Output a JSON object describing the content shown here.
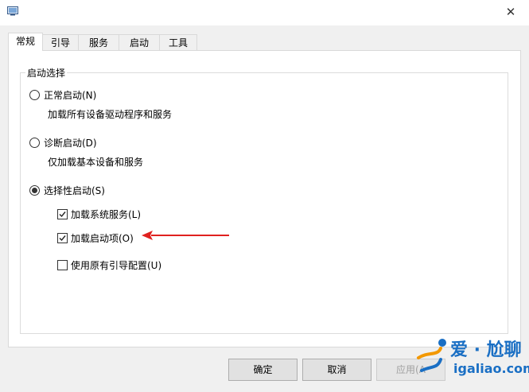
{
  "window": {
    "close_glyph": "✕"
  },
  "tabs": [
    {
      "label": "常规",
      "active": true
    },
    {
      "label": "引导"
    },
    {
      "label": "服务"
    },
    {
      "label": "启动"
    },
    {
      "label": "工具"
    }
  ],
  "startup_selection": {
    "group_title": "启动选择",
    "normal": {
      "label": "正常启动(N)",
      "desc": "加载所有设备驱动程序和服务",
      "selected": false
    },
    "diagnostic": {
      "label": "诊断启动(D)",
      "desc": "仅加载基本设备和服务",
      "selected": false
    },
    "selective": {
      "label": "选择性启动(S)",
      "selected": true,
      "options": [
        {
          "label": "加载系统服务(L)",
          "checked": true
        },
        {
          "label": "加载启动项(O)",
          "checked": true
        },
        {
          "label": "使用原有引导配置(U)",
          "checked": false
        }
      ]
    }
  },
  "buttons": {
    "ok": "确定",
    "cancel": "取消",
    "apply": "应用(A"
  },
  "watermark": {
    "brand": "爱 · 尬聊",
    "url": "igaliao.com"
  },
  "colors": {
    "arrow": "#e0211f",
    "watermark_blue": "#1a6fc4",
    "watermark_orange": "#f39800"
  }
}
